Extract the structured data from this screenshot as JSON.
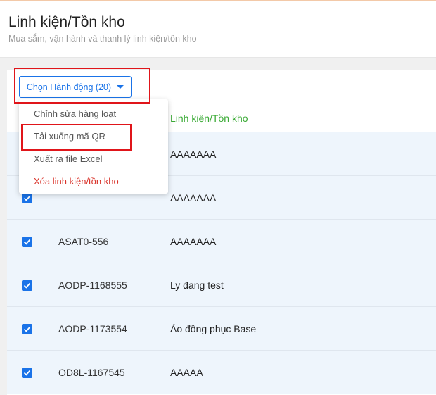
{
  "header": {
    "title": "Linh kiện/Tồn kho",
    "subtitle": "Mua sắm, vận hành và thanh lý linh kiện/tồn kho"
  },
  "toolbar": {
    "action_button_label": "Chọn Hành động (20)"
  },
  "table": {
    "columns": [
      "Linh kiện/Tồn kho"
    ],
    "rows": [
      {
        "code": "",
        "name": "AAAAAAA",
        "checked": true
      },
      {
        "code": "",
        "name": "AAAAAAA",
        "checked": true
      },
      {
        "code": "ASAT0-556",
        "name": "AAAAAAA",
        "checked": true
      },
      {
        "code": "AODP-1168555",
        "name": "Ly đang test",
        "checked": true
      },
      {
        "code": "AODP-1173554",
        "name": "Áo đồng phục Base",
        "checked": true
      },
      {
        "code": "OD8L-1167545",
        "name": "AAAAA",
        "checked": true
      }
    ]
  },
  "dropdown": {
    "items": [
      {
        "label": "Chỉnh sửa hàng loạt"
      },
      {
        "label": "Tải xuống mã QR"
      },
      {
        "label": "Xuất ra file Excel"
      },
      {
        "label": "Xóa linh kiện/tồn kho"
      }
    ]
  },
  "colors": {
    "accent": "#1a73e8",
    "column_header": "#3aaa35",
    "danger": "#d9342b",
    "highlight": "#e0151a",
    "row_bg": "#eef5fc"
  }
}
